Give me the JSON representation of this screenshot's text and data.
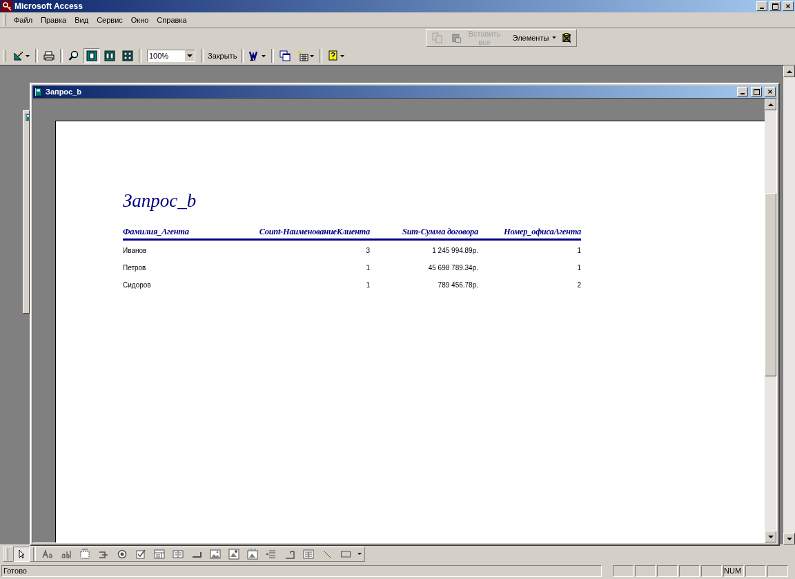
{
  "app": {
    "title": "Microsoft Access"
  },
  "menu": [
    "Файл",
    "Правка",
    "Вид",
    "Сервис",
    "Окно",
    "Справка"
  ],
  "clipboard_toolbar": {
    "copy": {
      "disabled": true
    },
    "paste_all": {
      "label": "Вставить все",
      "disabled": true
    },
    "elements": {
      "label": "Элементы"
    }
  },
  "preview_toolbar": {
    "views": [
      {
        "selected": true
      },
      {
        "selected": false
      },
      {
        "selected": false
      }
    ],
    "zoom": "100%",
    "close": "Закрыть"
  },
  "window": {
    "title": "Запрос_b"
  },
  "report": {
    "title": "Запрос_b",
    "columns": [
      "Фамилия_Агента",
      "Count-НаименованиеКлиента",
      "Sum-Сумма договора",
      "Номер_офисаАгента"
    ],
    "rows": [
      [
        "Иванов",
        "3",
        "1 245 994.89р.",
        "1"
      ],
      [
        "Петров",
        "1",
        "45 698 789.34р.",
        "1"
      ],
      [
        "Сидоров",
        "1",
        "789 456.78р.",
        "2"
      ]
    ]
  },
  "toolbox": {
    "pointer": {
      "selected": true
    }
  },
  "status_bar": {
    "text": "Готово",
    "num_indicator": "NUM"
  }
}
